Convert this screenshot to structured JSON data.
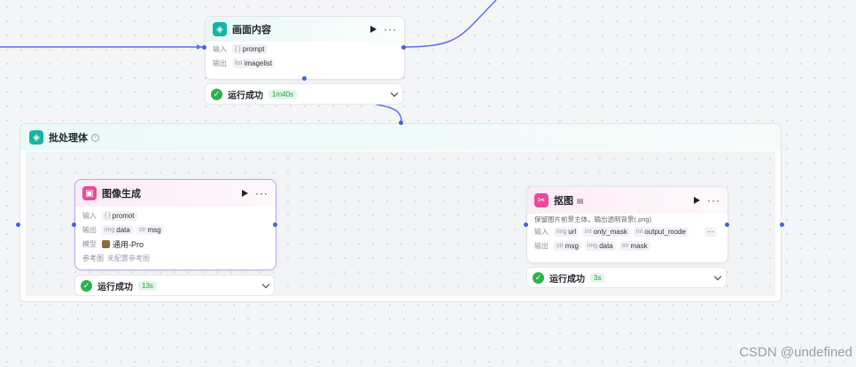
{
  "top_node": {
    "title": "画面内容",
    "input_label": "输入",
    "output_label": "输出",
    "input": {
      "type": "{ }",
      "name": "prompt"
    },
    "output": {
      "type": "list",
      "name": "imagelist"
    },
    "status": "运行成功",
    "time": "1m40s"
  },
  "batch": {
    "title": "批处理体"
  },
  "image_gen_node": {
    "title": "图像生成",
    "input_label": "输入",
    "output_label": "输出",
    "model_label": "模型",
    "ref_label": "参考图",
    "input": {
      "type": "{ }",
      "name": "promot"
    },
    "outputs": [
      {
        "type": "img",
        "name": "data"
      },
      {
        "type": "str",
        "name": "msg"
      }
    ],
    "model": "通用-Pro",
    "ref_value": "未配置参考图",
    "status": "运行成功",
    "time": "13s"
  },
  "matting_node": {
    "title": "抠图",
    "description": "保留图片前景主体，输出透明背景(.png)",
    "input_label": "输入",
    "output_label": "输出",
    "inputs": [
      {
        "type": "img",
        "name": "url"
      },
      {
        "type": "int",
        "name": "only_mask"
      },
      {
        "type": "int",
        "name": "output_mode"
      }
    ],
    "outputs": [
      {
        "type": "str",
        "name": "msg"
      },
      {
        "type": "img",
        "name": "data"
      },
      {
        "type": "str",
        "name": "mask"
      }
    ],
    "status": "运行成功",
    "time": "3s"
  },
  "watermark": "CSDN @undefined",
  "colors": {
    "accent": "#4a5de8",
    "success": "#2bb24c",
    "teal": "#17b3a3",
    "pink": "#e84a9c"
  }
}
